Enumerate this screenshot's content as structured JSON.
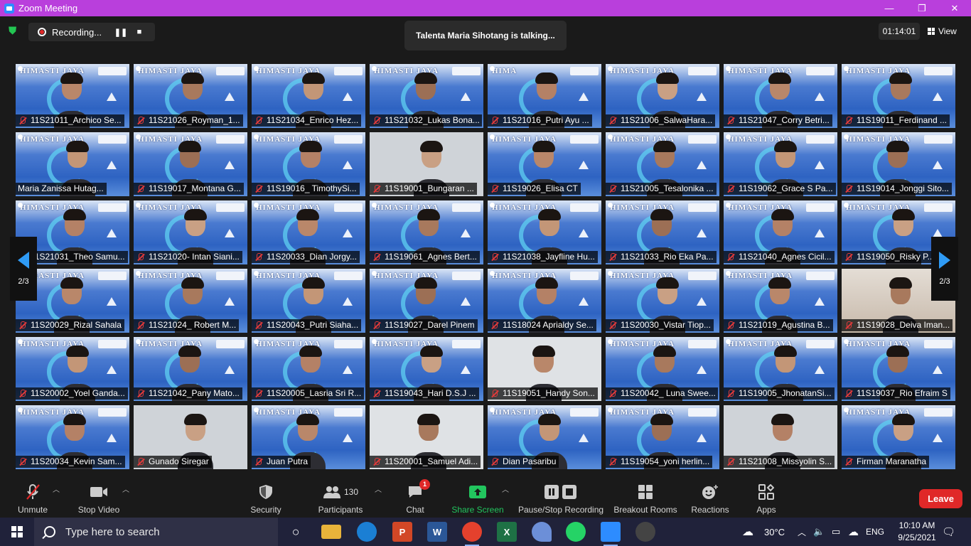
{
  "window": {
    "title": "Zoom Meeting",
    "minimize": "—",
    "restore": "❐",
    "close": "✕"
  },
  "top": {
    "recording_label": "Recording...",
    "pause_icon": "❚❚",
    "stop_icon": "■",
    "talking": "Talenta Maria Sihotang is talking...",
    "timer": "01:14:01",
    "view_label": "View"
  },
  "gallery": {
    "page_left": "2/3",
    "page_right": "2/3",
    "tiles": [
      {
        "name": "11S21011_Archico Se...",
        "muted": true,
        "bg": "vb",
        "banner": "HIMASTI JAYA"
      },
      {
        "name": "11S21026_Royman_1...",
        "muted": true,
        "bg": "vb",
        "banner": "HIMASTI JAYA"
      },
      {
        "name": "11S21034_Enrico Hez...",
        "muted": true,
        "bg": "vb",
        "banner": "HIMASTI JAYA"
      },
      {
        "name": "11S21032_Lukas Bona...",
        "muted": true,
        "bg": "vb",
        "banner": "HIMASTI JAYA"
      },
      {
        "name": "11S21016_Putri Ayu ...",
        "muted": true,
        "bg": "vb",
        "banner": "HIMA"
      },
      {
        "name": "11S21006_SalwaHara...",
        "muted": true,
        "bg": "vb",
        "banner": "HIMASTI JAYA"
      },
      {
        "name": "11S21047_Corry Betri...",
        "muted": true,
        "bg": "vb",
        "banner": "HIMASTI JAYA"
      },
      {
        "name": "11S19011_Ferdinand ...",
        "muted": true,
        "bg": "vb",
        "banner": "HIMASTI JAYA"
      },
      {
        "name": "Maria Zanissa Hutag...",
        "muted": false,
        "bg": "vb",
        "banner": "HIMASTI JAYA"
      },
      {
        "name": "11S19017_Montana G...",
        "muted": true,
        "bg": "vb",
        "banner": "HIMASTI JAYA"
      },
      {
        "name": "11S19016_ TimothySi...",
        "muted": true,
        "bg": "vb",
        "banner": "HIMASTI JAYA"
      },
      {
        "name": "11S19001_Bungaran ...",
        "muted": true,
        "bg": "plain",
        "banner": ""
      },
      {
        "name": "11S19026_Elisa CT",
        "muted": true,
        "bg": "vb",
        "banner": "HIMASTI JAYA"
      },
      {
        "name": "11S21005_Tesalonika ...",
        "muted": true,
        "bg": "vb",
        "banner": "HIMASTI JAYA"
      },
      {
        "name": "11S19062_Grace S Pa...",
        "muted": true,
        "bg": "vb",
        "banner": "HIMASTI JAYA"
      },
      {
        "name": "11S19014_Jonggi Sito...",
        "muted": true,
        "bg": "vb",
        "banner": "HIMASTI JAYA"
      },
      {
        "name": "11S21031_Theo Samu...",
        "muted": true,
        "bg": "vb",
        "banner": "HIMASTI JAYA"
      },
      {
        "name": "11S21020- Intan Siani...",
        "muted": true,
        "bg": "vb",
        "banner": "HIMASTI JAYA"
      },
      {
        "name": "11S20033_Dian Jorgy...",
        "muted": true,
        "bg": "vb",
        "banner": "HIMASTI JAYA"
      },
      {
        "name": "11S19061_Agnes Bert...",
        "muted": true,
        "bg": "vb",
        "banner": "HIMASTI JAYA"
      },
      {
        "name": "11S21038_Jayfline Hu...",
        "muted": true,
        "bg": "vb",
        "banner": "HIMASTI JAYA"
      },
      {
        "name": "11S21033_Rio Eka Pa...",
        "muted": true,
        "bg": "vb",
        "banner": "HIMASTI JAYA"
      },
      {
        "name": "11S21040_Agnes Cicil...",
        "muted": true,
        "bg": "vb",
        "banner": "HIMASTI JAYA"
      },
      {
        "name": "11S19050_Risky P...",
        "muted": true,
        "bg": "vb",
        "banner": "HIMASTI JAYA"
      },
      {
        "name": "11S20029_Rizal Sahala",
        "muted": true,
        "bg": "vb",
        "banner": "HIMASTI JAYA"
      },
      {
        "name": "11S21024_ Robert M...",
        "muted": true,
        "bg": "vb",
        "banner": "HIMASTI JAYA"
      },
      {
        "name": "11S20043_Putri Siaha...",
        "muted": true,
        "bg": "vb",
        "banner": "HIMASTI JAYA"
      },
      {
        "name": "11S19027_Darel Pinem",
        "muted": true,
        "bg": "vb",
        "banner": "HIMASTI JAYA"
      },
      {
        "name": "11S18024 Aprialdy Se...",
        "muted": true,
        "bg": "vb",
        "banner": "HIMASTI JAYA"
      },
      {
        "name": "11S20030_Vistar Tiop...",
        "muted": true,
        "bg": "vb",
        "banner": "HIMASTI JAYA"
      },
      {
        "name": "11S21019_Agustina B...",
        "muted": true,
        "bg": "vb",
        "banner": "HIMASTI JAYA"
      },
      {
        "name": "11S19028_Deiva Iman...",
        "muted": true,
        "bg": "room",
        "banner": ""
      },
      {
        "name": "11S20002_Yoel Ganda...",
        "muted": true,
        "bg": "vb",
        "banner": "HIMASTI JAYA"
      },
      {
        "name": "11S21042_Pany Mato...",
        "muted": true,
        "bg": "vb",
        "banner": "HIMASTI JAYA"
      },
      {
        "name": "11S20005_Lasria Sri R...",
        "muted": true,
        "bg": "vb",
        "banner": "HIMASTI JAYA"
      },
      {
        "name": "11S19043_Hari D.S.J ...",
        "muted": true,
        "bg": "vb",
        "banner": "HIMASTI JAYA"
      },
      {
        "name": "11S19051_Handy Son...",
        "muted": true,
        "bg": "light",
        "banner": ""
      },
      {
        "name": "11S20042_ Luna Swee...",
        "muted": true,
        "bg": "vb",
        "banner": "HIMASTI JAYA"
      },
      {
        "name": "11S19005_JhonatanSi...",
        "muted": true,
        "bg": "vb",
        "banner": "HIMASTI JAYA"
      },
      {
        "name": "11S19037_Rio Efraim S",
        "muted": true,
        "bg": "vb",
        "banner": "HIMASTI JAYA"
      },
      {
        "name": "11S20034_Kevin Sam...",
        "muted": true,
        "bg": "vb",
        "banner": "HIMASTI JAYA"
      },
      {
        "name": "Gunado Siregar",
        "muted": true,
        "bg": "plain",
        "banner": ""
      },
      {
        "name": "Juan Putra",
        "muted": true,
        "bg": "vb",
        "banner": "HIMASTI JAYA"
      },
      {
        "name": "11S20001_Samuel Adi...",
        "muted": true,
        "bg": "light",
        "banner": ""
      },
      {
        "name": "Dian Pasaribu",
        "muted": true,
        "bg": "vb",
        "banner": "HIMASTI JAYA"
      },
      {
        "name": "11S19054_yoni herlin...",
        "muted": true,
        "bg": "vb",
        "banner": "HIMASTI JAYA"
      },
      {
        "name": "11S21008_Missyolin S...",
        "muted": true,
        "bg": "plain",
        "banner": ""
      },
      {
        "name": "Firman Maranatha",
        "muted": true,
        "bg": "vb",
        "banner": "HIMASTI JAYA"
      }
    ]
  },
  "toolbar": {
    "unmute": "Unmute",
    "stop_video": "Stop Video",
    "security": "Security",
    "participants": "Participants",
    "participants_count": "130",
    "chat": "Chat",
    "chat_badge": "1",
    "share_screen": "Share Screen",
    "pause_stop_recording": "Pause/Stop Recording",
    "breakout_rooms": "Breakout Rooms",
    "reactions": "Reactions",
    "apps": "Apps",
    "leave": "Leave"
  },
  "taskbar": {
    "search_placeholder": "Type here to search",
    "temperature": "30°C",
    "language": "ENG",
    "time": "10:10 AM",
    "date": "9/25/2021"
  },
  "colors": {
    "title_bar": "#b93fdc",
    "leave": "#e02828",
    "active_speaker": "#3ecf2f",
    "share": "#22c55e",
    "nav_arrow": "#2f9bf5"
  }
}
